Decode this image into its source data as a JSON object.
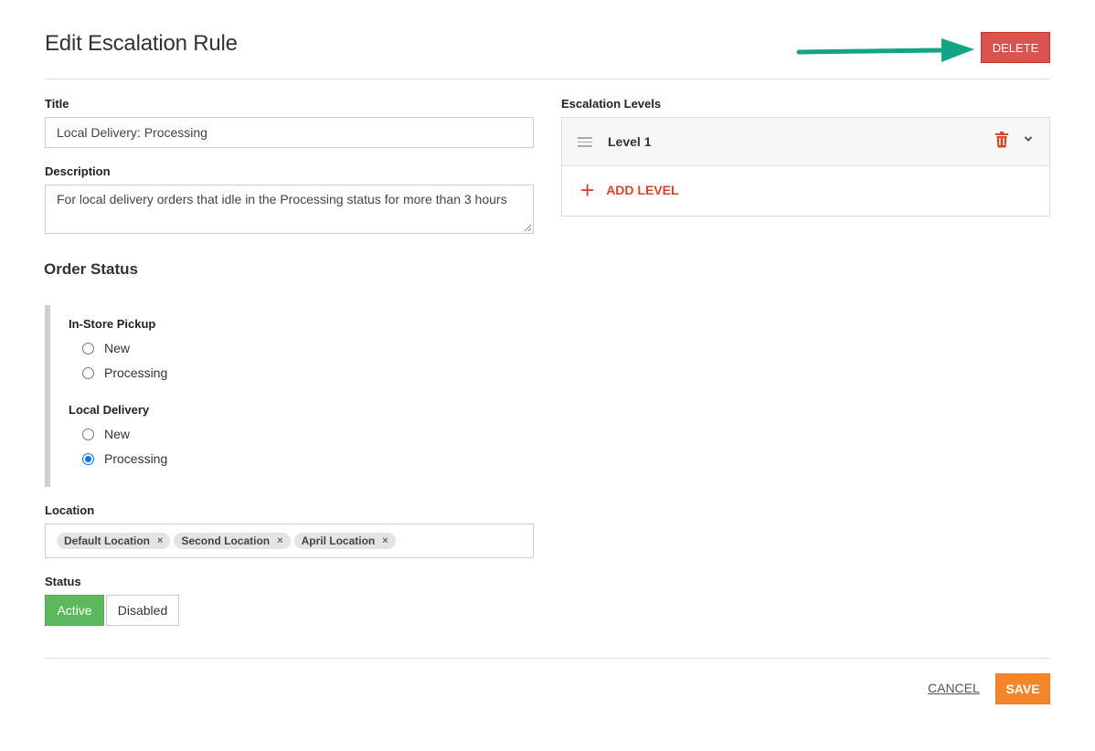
{
  "header": {
    "title": "Edit Escalation Rule",
    "delete_label": "DELETE",
    "arrow_color": "#13a386"
  },
  "form": {
    "title": {
      "label": "Title",
      "value": "Local Delivery: Processing"
    },
    "description": {
      "label": "Description",
      "value": "For local delivery orders that idle in the Processing status for more than 3 hours"
    },
    "order_status": {
      "heading": "Order Status",
      "groups": [
        {
          "label": "In-Store Pickup",
          "options": [
            {
              "label": "New",
              "checked": false
            },
            {
              "label": "Processing",
              "checked": false
            }
          ]
        },
        {
          "label": "Local Delivery",
          "options": [
            {
              "label": "New",
              "checked": false
            },
            {
              "label": "Processing",
              "checked": true
            }
          ]
        }
      ]
    },
    "location": {
      "label": "Location",
      "tags": [
        "Default Location",
        "Second Location",
        "April Location"
      ],
      "remove_glyph": "×"
    },
    "status": {
      "label": "Status",
      "active_label": "Active",
      "disabled_label": "Disabled",
      "selected": "Active"
    }
  },
  "escalation": {
    "label": "Escalation Levels",
    "levels": [
      {
        "name": "Level 1"
      }
    ],
    "add_label": "ADD LEVEL",
    "add_glyph": "+"
  },
  "footer": {
    "cancel_label": "CANCEL",
    "save_label": "SAVE"
  },
  "colors": {
    "delete": "#d9534f",
    "active": "#5cb85c",
    "save": "#f5852a",
    "accent_red": "#d9432b",
    "radio": "#0075ff"
  }
}
